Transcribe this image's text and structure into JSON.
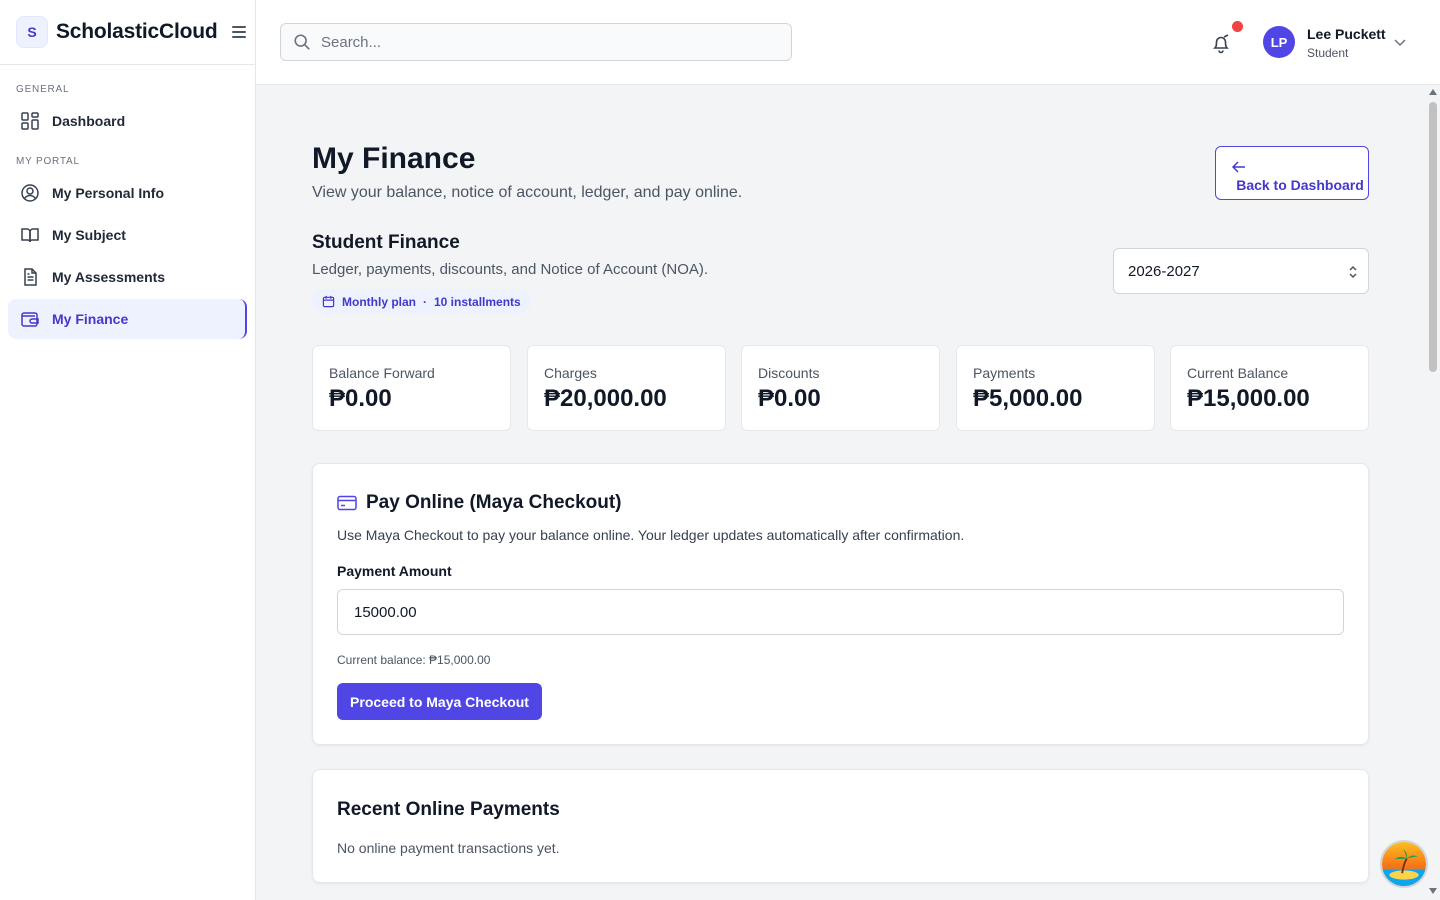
{
  "brand": {
    "logo_letter": "S",
    "name": "ScholasticCloud"
  },
  "sidebar": {
    "sections": [
      {
        "label": "GENERAL"
      },
      {
        "label": "MY PORTAL"
      }
    ],
    "items": [
      {
        "label": "Dashboard",
        "icon": "grid-icon"
      },
      {
        "label": "My Personal Info",
        "icon": "user-circle-icon"
      },
      {
        "label": "My Subject",
        "icon": "book-open-icon"
      },
      {
        "label": "My Assessments",
        "icon": "document-icon"
      },
      {
        "label": "My Finance",
        "icon": "wallet-icon",
        "active": true
      }
    ]
  },
  "header": {
    "search": {
      "placeholder": "Search..."
    },
    "user": {
      "initials": "LP",
      "name": "Lee Puckett",
      "role": "Student"
    },
    "notification_dot_color": "#ef4444"
  },
  "page": {
    "title": "My Finance",
    "subtitle": "View your balance, notice of account, ledger, and pay online.",
    "back_button": "Back to Dashboard"
  },
  "student_finance": {
    "title": "Student Finance",
    "subtitle": "Ledger, payments, discounts, and Notice of Account (NOA).",
    "plan": "Monthly plan",
    "plan_separator": "·",
    "installments": "10 installments",
    "school_year": "2026-2027"
  },
  "stats": [
    {
      "label": "Balance Forward",
      "value": "₱0.00"
    },
    {
      "label": "Charges",
      "value": "₱20,000.00"
    },
    {
      "label": "Discounts",
      "value": "₱0.00"
    },
    {
      "label": "Payments",
      "value": "₱5,000.00"
    },
    {
      "label": "Current Balance",
      "value": "₱15,000.00"
    }
  ],
  "pay_online": {
    "title": "Pay Online (Maya Checkout)",
    "description": "Use Maya Checkout to pay your balance online. Your ledger updates automatically after confirmation.",
    "amount_label": "Payment Amount",
    "amount_value": "15000.00",
    "current_balance_note": "Current balance: ₱15,000.00",
    "button": "Proceed to Maya Checkout"
  },
  "recent_payments": {
    "title": "Recent Online Payments",
    "empty_text": "No online payment transactions yet."
  },
  "colors": {
    "accent": "#4f46e5",
    "accent_light": "#eef2ff",
    "text": "#111827"
  }
}
